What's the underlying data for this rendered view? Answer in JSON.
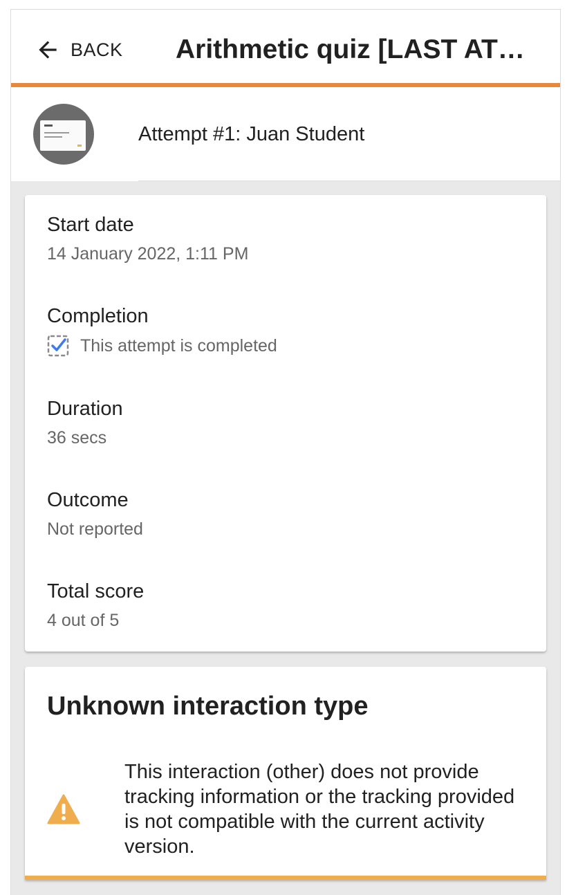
{
  "header": {
    "back_label": "BACK",
    "title": "Arithmetic quiz [LAST ATTEMPT]"
  },
  "attempt": {
    "title": "Attempt #1: Juan Student"
  },
  "details": {
    "start_date_label": "Start date",
    "start_date_value": "14 January 2022, 1:11 PM",
    "completion_label": "Completion",
    "completion_value": "This attempt is completed",
    "duration_label": "Duration",
    "duration_value": "36 secs",
    "outcome_label": "Outcome",
    "outcome_value": "Not reported",
    "total_score_label": "Total score",
    "total_score_value": "4 out of 5"
  },
  "interaction": {
    "title": "Unknown interaction type",
    "message": "This interaction (other) does not provide tracking information or the tracking provided is not compatible with the current activity version."
  },
  "colors": {
    "accent": "#e8883a",
    "warning": "#f0ad4e",
    "check": "#3c7bea"
  },
  "icons": {
    "back": "arrow-left-icon",
    "completion": "checkbox-checked-icon",
    "warning": "warning-icon"
  }
}
